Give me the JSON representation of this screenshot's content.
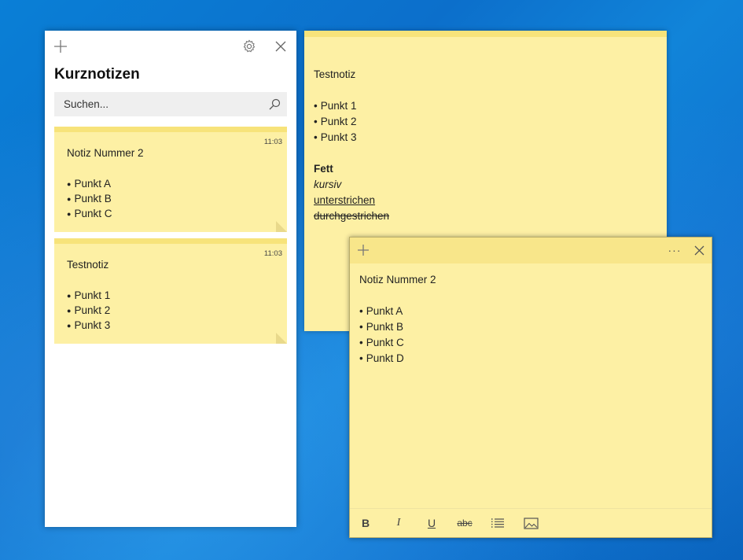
{
  "list": {
    "title": "Kurznotizen",
    "search_placeholder": "Suchen...",
    "notes": [
      {
        "time": "11:03",
        "title": "Notiz Nummer 2",
        "items": [
          "Punkt A",
          "Punkt B",
          "Punkt C"
        ]
      },
      {
        "time": "11:03",
        "title": "Testnotiz",
        "items": [
          "Punkt 1",
          "Punkt 2",
          "Punkt 3"
        ]
      }
    ]
  },
  "note_a": {
    "title": "Testnotiz",
    "items": [
      "Punkt 1",
      "Punkt 2",
      "Punkt 3"
    ],
    "bold": "Fett",
    "italic": "kursiv",
    "underline": "unterstrichen",
    "strike": "durchgestrichen"
  },
  "note_b": {
    "title": "Notiz Nummer 2",
    "items": [
      "Punkt A",
      "Punkt B",
      "Punkt C",
      "Punkt D"
    ],
    "toolbar": {
      "bold": "B",
      "italic": "I",
      "underline": "U",
      "strike": "abc"
    },
    "menu_glyph": "···"
  },
  "colors": {
    "note_bg": "#fdf0a4",
    "note_bar": "#f7e37a",
    "desktop": "#0c6fcb"
  }
}
